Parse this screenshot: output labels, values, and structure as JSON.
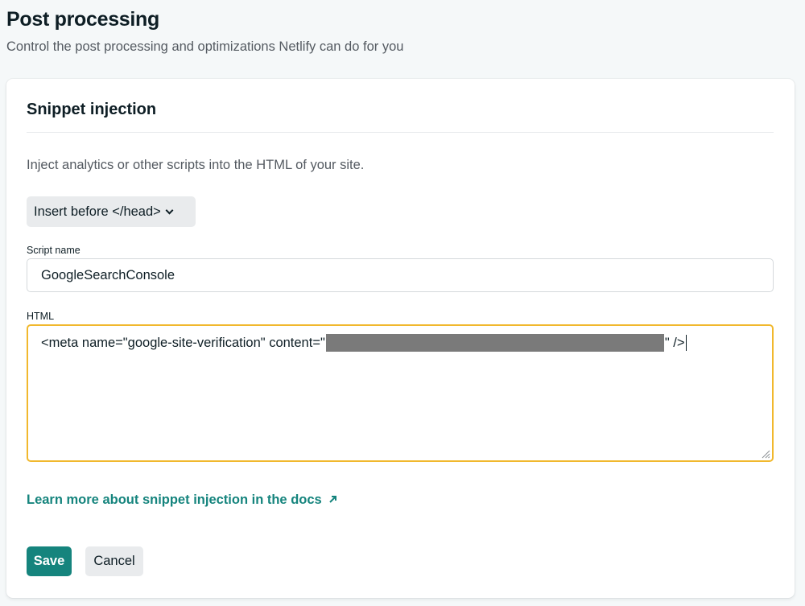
{
  "header": {
    "title": "Post processing",
    "subtitle": "Control the post processing and optimizations Netlify can do for you"
  },
  "snippet": {
    "title": "Snippet injection",
    "description": "Inject analytics or other scripts into the HTML of your site.",
    "position_select": {
      "selected": "Insert before </head>"
    },
    "script_name": {
      "label": "Script name",
      "value": "GoogleSearchConsole"
    },
    "html": {
      "label": "HTML",
      "prefix": "<meta name=\"google-site-verification\" content=\"",
      "suffix": "\" />"
    },
    "docs_link": {
      "label": "Learn more about snippet injection in the docs",
      "icon": "arrow-up-right-icon"
    },
    "actions": {
      "save_label": "Save",
      "cancel_label": "Cancel"
    }
  },
  "colors": {
    "accent": "#15847d",
    "focus_border": "#f1b82d",
    "background": "#f5f8f9"
  }
}
